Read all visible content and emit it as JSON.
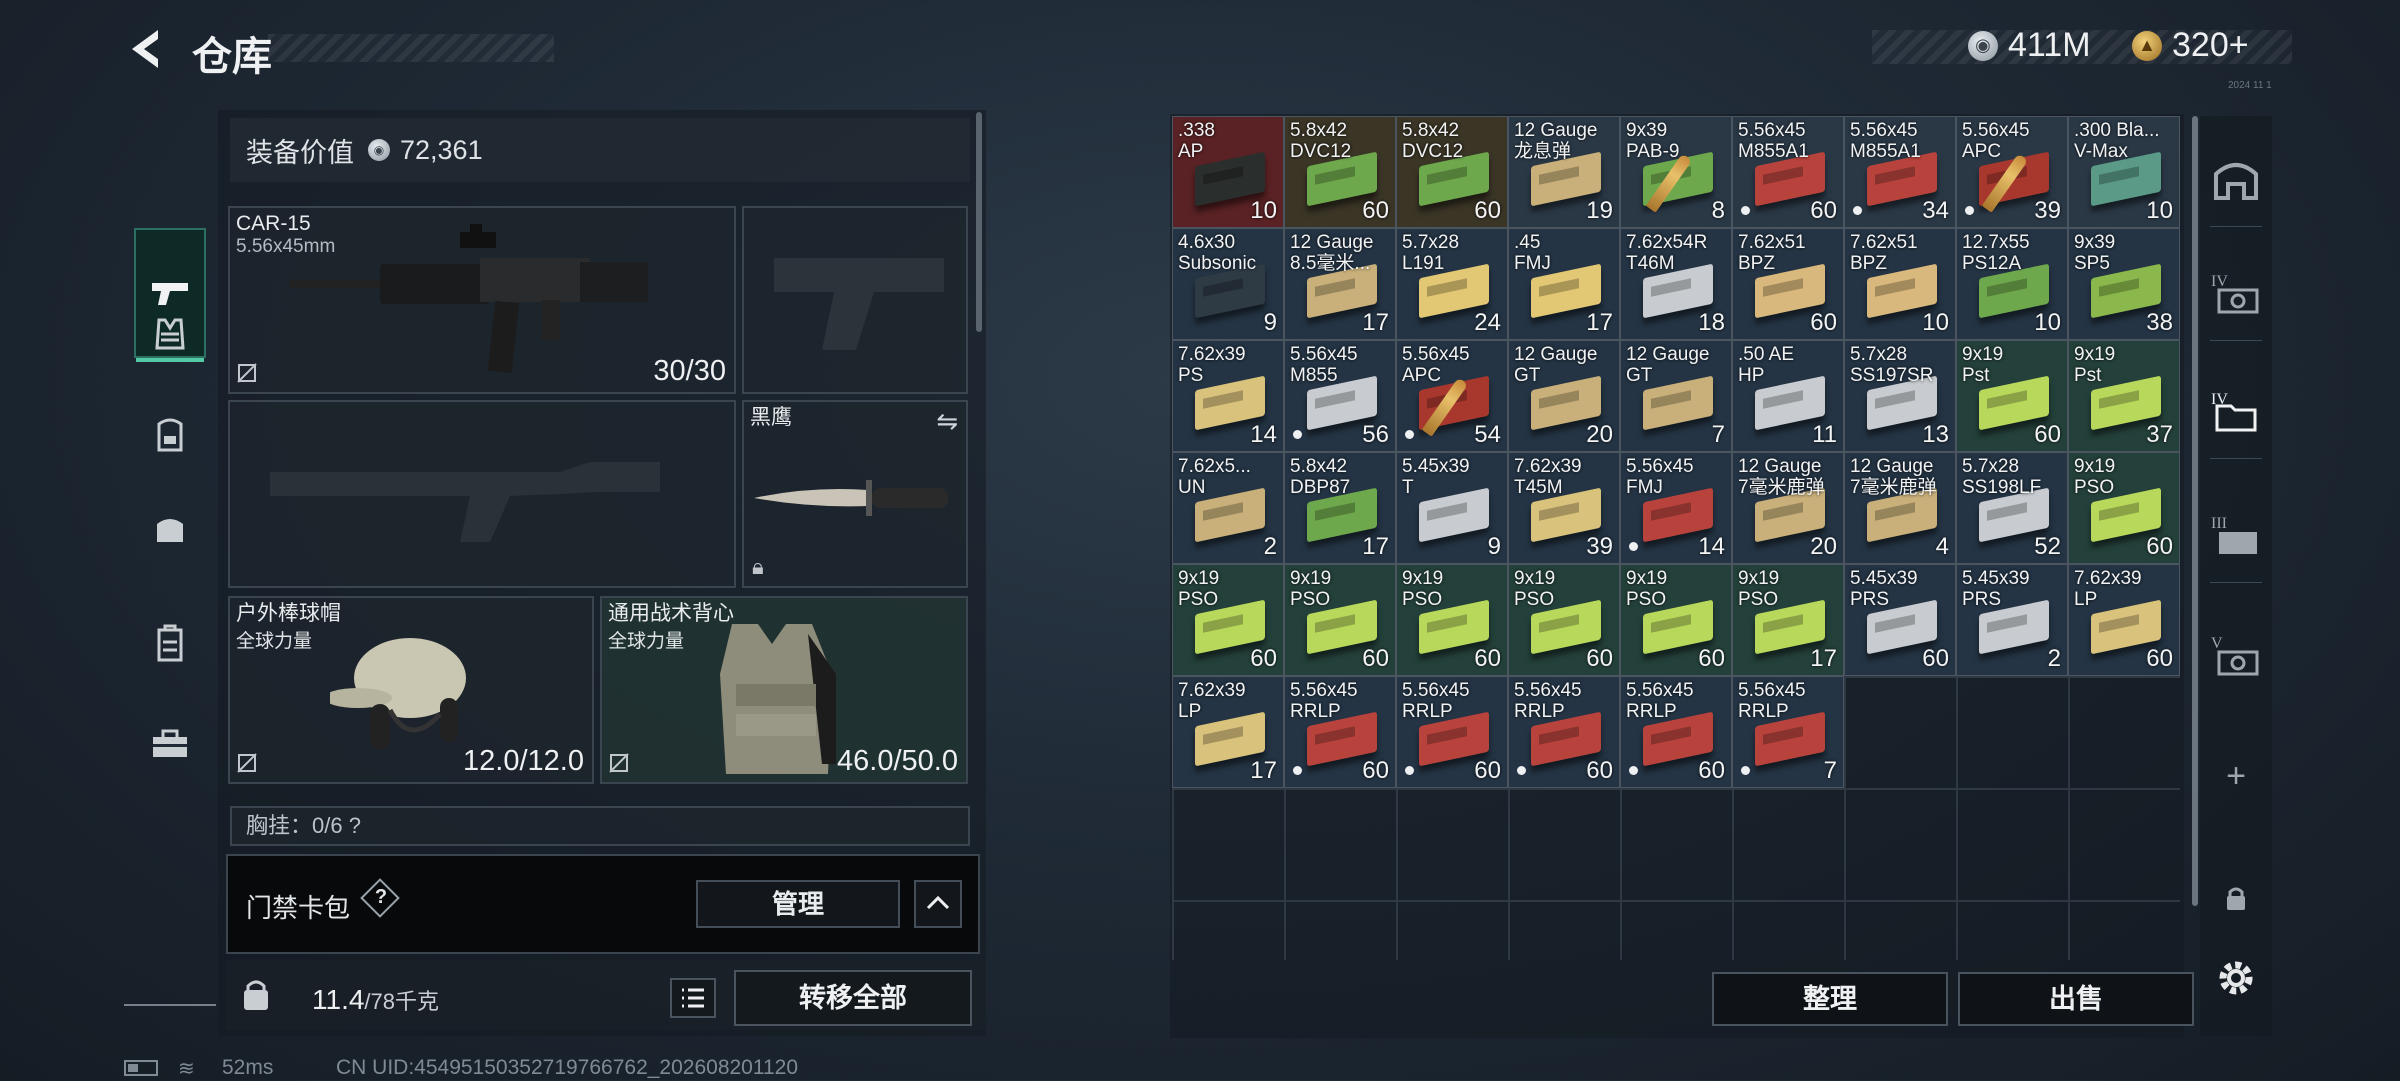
{
  "header": {
    "title": "仓库",
    "currency_silver": "411M",
    "currency_gold": "320+",
    "mini_text": "2024 11 1"
  },
  "equipment": {
    "value_label": "装备价值",
    "value": "72,361",
    "primary_weapon": {
      "name": "CAR-15",
      "caliber": "5.56x45mm",
      "ammo": "30/30"
    },
    "melee": {
      "name": "黑鹰"
    },
    "helmet": {
      "name": "户外棒球帽",
      "sub": "全球力量",
      "durability": "12.0/12.0"
    },
    "armor": {
      "name": "通用战术背心",
      "sub": "全球力量",
      "durability": "46.0/50.0"
    },
    "chest_rig": {
      "label": "胸挂：0/6  ?"
    }
  },
  "access_pack": {
    "label": "门禁卡包",
    "manage": "管理"
  },
  "weight": {
    "current": "11.4",
    "max": "/78千克"
  },
  "transfer_all": "转移全部",
  "status": {
    "ping": "52ms",
    "uid": "CN UID:4549515035271976676​2_202608201120"
  },
  "inventory": {
    "items": [
      {
        "name": ".338\nAP",
        "count": "10",
        "box": "#2a2e2c",
        "dot": false,
        "bullet": false,
        "bg": "#5a2224"
      },
      {
        "name": "5.8x42\nDVC12",
        "count": "60",
        "box": "#6ea84c",
        "dot": false,
        "bullet": false,
        "bg": "#3b3526"
      },
      {
        "name": "5.8x42\nDVC12",
        "count": "60",
        "box": "#6ea84c",
        "dot": false,
        "bullet": false,
        "bg": "#3b3526"
      },
      {
        "name": "12 Gauge\n龙息弹",
        "count": "19",
        "box": "#c9b07a",
        "dot": false,
        "bullet": false,
        "bg": "#2a3846"
      },
      {
        "name": "9x39\nPAB-9",
        "count": "8",
        "box": "#6ea84c",
        "dot": false,
        "bullet": true,
        "bg": "#2a3846"
      },
      {
        "name": "5.56x45\nM855A1",
        "count": "60",
        "box": "#b8433c",
        "dot": true,
        "bullet": false,
        "bg": "#2a3846"
      },
      {
        "name": "5.56x45\nM855A1",
        "count": "34",
        "box": "#b8433c",
        "dot": true,
        "bullet": false,
        "bg": "#2a3846"
      },
      {
        "name": "5.56x45\nAPC",
        "count": "39",
        "box": "#a8382e",
        "dot": true,
        "bullet": true,
        "bg": "#2a3846"
      },
      {
        "name": ".300 Bla...\nV-Max",
        "count": "10",
        "box": "#5a9a86",
        "dot": false,
        "bullet": false,
        "bg": "#2a3846"
      },
      {
        "name": "4.6x30\nSubsonic",
        "count": "9",
        "box": "#2e3a44",
        "dot": false,
        "bullet": false,
        "bg": "#243444"
      },
      {
        "name": "12 Gauge\n8.5毫米...",
        "count": "17",
        "box": "#c9b07a",
        "dot": false,
        "bullet": false,
        "bg": "#243444"
      },
      {
        "name": "5.7x28\nL191",
        "count": "24",
        "box": "#e2c874",
        "dot": false,
        "bullet": false,
        "bg": "#243444"
      },
      {
        "name": ".45\nFMJ",
        "count": "17",
        "box": "#e2c874",
        "dot": false,
        "bullet": false,
        "bg": "#243444"
      },
      {
        "name": "7.62x54R\nT46M",
        "count": "18",
        "box": "#c8ccd0",
        "dot": false,
        "bullet": false,
        "bg": "#243444"
      },
      {
        "name": "7.62x51\nBPZ",
        "count": "60",
        "box": "#d8b87c",
        "dot": false,
        "bullet": false,
        "bg": "#243444"
      },
      {
        "name": "7.62x51\nBPZ",
        "count": "10",
        "box": "#d8b87c",
        "dot": false,
        "bullet": false,
        "bg": "#243444"
      },
      {
        "name": "12.7x55\nPS12A",
        "count": "10",
        "box": "#6ea84c",
        "dot": false,
        "bullet": false,
        "bg": "#243444"
      },
      {
        "name": "9x39\nSP5",
        "count": "38",
        "box": "#8ab84c",
        "dot": false,
        "bullet": false,
        "bg": "#243444"
      },
      {
        "name": "7.62x39\nPS",
        "count": "14",
        "box": "#d8c27c",
        "dot": false,
        "bullet": false,
        "bg": "#243444"
      },
      {
        "name": "5.56x45\nM855",
        "count": "56",
        "box": "#c8ccd0",
        "dot": true,
        "bullet": false,
        "bg": "#243444"
      },
      {
        "name": "5.56x45\nAPC",
        "count": "54",
        "box": "#a8382e",
        "dot": true,
        "bullet": true,
        "bg": "#243444"
      },
      {
        "name": "12 Gauge\nGT",
        "count": "20",
        "box": "#c9b07a",
        "dot": false,
        "bullet": false,
        "bg": "#243444"
      },
      {
        "name": "12 Gauge\nGT",
        "count": "7",
        "box": "#c9b07a",
        "dot": false,
        "bullet": false,
        "bg": "#243444"
      },
      {
        "name": ".50 AE\nHP",
        "count": "11",
        "box": "#c8ccd0",
        "dot": false,
        "bullet": false,
        "bg": "#243444"
      },
      {
        "name": "5.7x28\nSS197SR",
        "count": "13",
        "box": "#c8ccd0",
        "dot": false,
        "bullet": false,
        "bg": "#243444"
      },
      {
        "name": "9x19\nPst",
        "count": "60",
        "box": "#b8d85c",
        "dot": false,
        "bullet": false,
        "bg": "#24403a"
      },
      {
        "name": "9x19\nPst",
        "count": "37",
        "box": "#b8d85c",
        "dot": false,
        "bullet": false,
        "bg": "#24403a"
      },
      {
        "name": "7.62x5...\nUN",
        "count": "2",
        "box": "#c9b07a",
        "dot": false,
        "bullet": false,
        "bg": "#243444"
      },
      {
        "name": "5.8x42\nDBP87",
        "count": "17",
        "box": "#6ea84c",
        "dot": false,
        "bullet": false,
        "bg": "#243444"
      },
      {
        "name": "5.45x39\nT",
        "count": "9",
        "box": "#c8ccd0",
        "dot": false,
        "bullet": false,
        "bg": "#243444"
      },
      {
        "name": "7.62x39\nT45M",
        "count": "39",
        "box": "#d8c27c",
        "dot": false,
        "bullet": false,
        "bg": "#243444"
      },
      {
        "name": "5.56x45\nFMJ",
        "count": "14",
        "box": "#b8433c",
        "dot": true,
        "bullet": false,
        "bg": "#243444"
      },
      {
        "name": "12 Gauge\n7毫米鹿弹",
        "count": "20",
        "box": "#c9b07a",
        "dot": false,
        "bullet": false,
        "bg": "#243444"
      },
      {
        "name": "12 Gauge\n7毫米鹿弹",
        "count": "4",
        "box": "#c9b07a",
        "dot": false,
        "bullet": false,
        "bg": "#243444"
      },
      {
        "name": "5.7x28\nSS198LF",
        "count": "52",
        "box": "#c8ccd0",
        "dot": false,
        "bullet": false,
        "bg": "#243444"
      },
      {
        "name": "9x19\nPSO",
        "count": "60",
        "box": "#b8d85c",
        "dot": false,
        "bullet": false,
        "bg": "#24403a"
      },
      {
        "name": "9x19\nPSO",
        "count": "60",
        "box": "#b8d85c",
        "dot": false,
        "bullet": false,
        "bg": "#24403a"
      },
      {
        "name": "9x19\nPSO",
        "count": "60",
        "box": "#b8d85c",
        "dot": false,
        "bullet": false,
        "bg": "#24403a"
      },
      {
        "name": "9x19\nPSO",
        "count": "60",
        "box": "#b8d85c",
        "dot": false,
        "bullet": false,
        "bg": "#24403a"
      },
      {
        "name": "9x19\nPSO",
        "count": "60",
        "box": "#b8d85c",
        "dot": false,
        "bullet": false,
        "bg": "#24403a"
      },
      {
        "name": "9x19\nPSO",
        "count": "60",
        "box": "#b8d85c",
        "dot": false,
        "bullet": false,
        "bg": "#24403a"
      },
      {
        "name": "9x19\nPSO",
        "count": "17",
        "box": "#b8d85c",
        "dot": false,
        "bullet": false,
        "bg": "#24403a"
      },
      {
        "name": "5.45x39\nPRS",
        "count": "60",
        "box": "#c8ccd0",
        "dot": false,
        "bullet": false,
        "bg": "#243444"
      },
      {
        "name": "5.45x39\nPRS",
        "count": "2",
        "box": "#c8ccd0",
        "dot": false,
        "bullet": false,
        "bg": "#243444"
      },
      {
        "name": "7.62x39\nLP",
        "count": "60",
        "box": "#d8c27c",
        "dot": false,
        "bullet": false,
        "bg": "#243444"
      },
      {
        "name": "7.62x39\nLP",
        "count": "17",
        "box": "#d8c27c",
        "dot": false,
        "bullet": false,
        "bg": "#243444"
      },
      {
        "name": "5.56x45\nRRLP",
        "count": "60",
        "box": "#b8433c",
        "dot": true,
        "bullet": false,
        "bg": "#243444"
      },
      {
        "name": "5.56x45\nRRLP",
        "count": "60",
        "box": "#b8433c",
        "dot": true,
        "bullet": false,
        "bg": "#243444"
      },
      {
        "name": "5.56x45\nRRLP",
        "count": "60",
        "box": "#b8433c",
        "dot": true,
        "bullet": false,
        "bg": "#243444"
      },
      {
        "name": "5.56x45\nRRLP",
        "count": "60",
        "box": "#b8433c",
        "dot": true,
        "bullet": false,
        "bg": "#243444"
      },
      {
        "name": "5.56x45\nRRLP",
        "count": "7",
        "box": "#b8433c",
        "dot": true,
        "bullet": false,
        "bg": "#243444"
      }
    ],
    "sort_label": "整理",
    "sell_label": "出售"
  },
  "right_strip": {
    "icons": [
      "safe-box-icon",
      "container-tier-iv-icon",
      "folder-tier-iv-icon",
      "container-tier-iii-icon",
      "container-tier-v-icon",
      "plus-icon",
      "lock-icon",
      "settings-icon"
    ]
  }
}
